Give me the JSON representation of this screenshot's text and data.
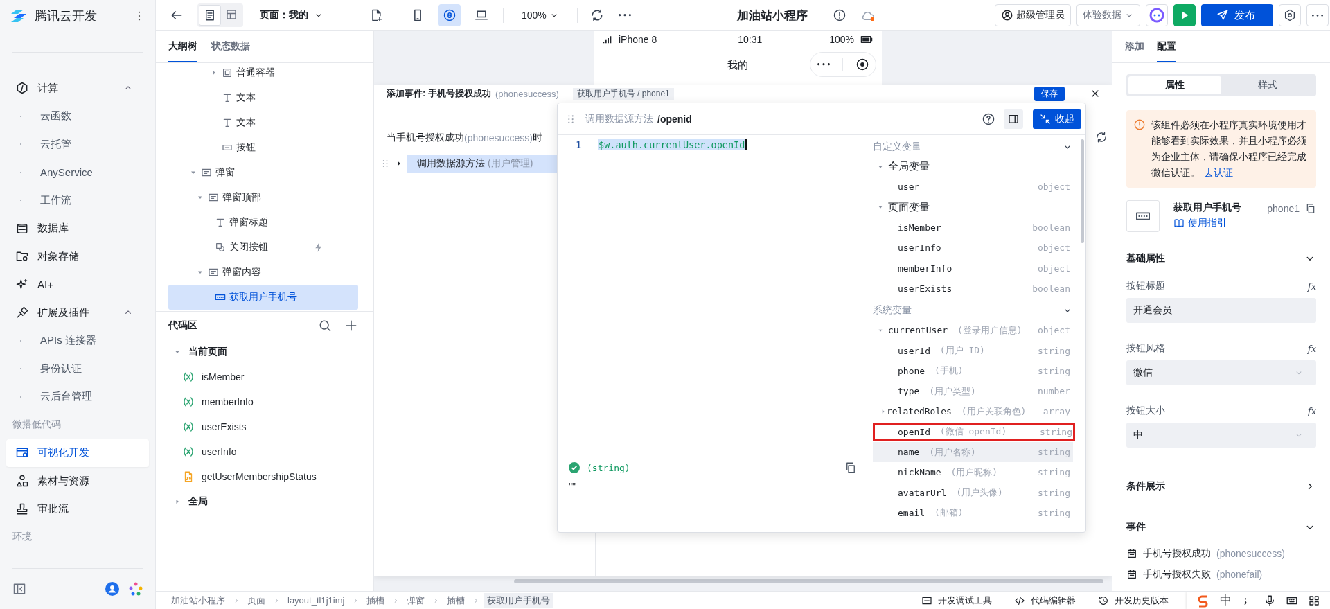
{
  "sidebar": {
    "brand": "腾讯云开发",
    "nav": [
      {
        "kind": "group",
        "label": "计算",
        "expanded": true,
        "children": [
          {
            "label": "云函数",
            "selected": false
          },
          {
            "label": "云托管",
            "selected": false
          },
          {
            "label": "AnyService",
            "selected": false
          },
          {
            "label": "工作流",
            "selected": false
          }
        ]
      },
      {
        "kind": "item",
        "label": "数据库",
        "selected": false
      },
      {
        "kind": "item",
        "label": "对象存储",
        "selected": false
      },
      {
        "kind": "item",
        "label": "AI+",
        "selected": false
      },
      {
        "kind": "group",
        "label": "扩展及插件",
        "expanded": true,
        "children": [
          {
            "label": "APIs 连接器",
            "selected": false
          },
          {
            "label": "身份认证",
            "selected": false
          },
          {
            "label": "云后台管理",
            "selected": false
          }
        ]
      },
      {
        "kind": "section",
        "label": "微搭低代码"
      },
      {
        "kind": "item",
        "label": "可视化开发",
        "selected": true
      },
      {
        "kind": "item",
        "label": "素材与资源",
        "selected": false
      },
      {
        "kind": "item",
        "label": "审批流",
        "selected": false
      },
      {
        "kind": "section",
        "label": "环境"
      }
    ]
  },
  "toolbar": {
    "view_modes": [
      {
        "selected": true
      },
      {
        "selected": false
      }
    ],
    "page": "页面：我的",
    "devices": [
      {
        "selected": false
      },
      {
        "selected": true
      },
      {
        "selected": false
      }
    ],
    "zoom": "100%",
    "app_title": "加油站小程序",
    "role": "超级管理员",
    "data_env": "体验数据",
    "publish": "发布"
  },
  "outline": {
    "tabs": [
      {
        "label": "大纲树",
        "selected": true
      },
      {
        "label": "状态数据",
        "selected": false
      }
    ],
    "continued": [
      {
        "kind": "container",
        "label": "普通容器",
        "expanded": false,
        "selected": false,
        "has_event": false
      },
      {
        "kind": "text",
        "label": "文本",
        "selected": false,
        "has_event": false
      },
      {
        "kind": "text",
        "label": "文本",
        "selected": false,
        "has_event": false
      },
      {
        "kind": "button",
        "label": "按钮",
        "selected": false,
        "has_event": false
      }
    ],
    "nodes": [
      {
        "kind": "popup",
        "label": "弹窗",
        "expanded": true,
        "selected": false,
        "has_event": false,
        "children": [
          {
            "kind": "popup",
            "label": "弹窗顶部",
            "expanded": true,
            "selected": false,
            "has_event": false,
            "children": [
              {
                "kind": "text",
                "label": "弹窗标题",
                "selected": false,
                "has_event": false
              },
              {
                "kind": "close-button",
                "label": "关闭按钮",
                "selected": false,
                "has_event": true
              }
            ]
          },
          {
            "kind": "popup",
            "label": "弹窗内容",
            "expanded": true,
            "selected": false,
            "has_event": false,
            "children": [
              {
                "kind": "phone-button",
                "label": "获取用户手机号",
                "selected": true,
                "has_event": false
              }
            ]
          }
        ]
      }
    ]
  },
  "code_area": {
    "title": "代码区",
    "groups": [
      {
        "label": "当前页面",
        "expanded": true,
        "children": [
          {
            "kind": "variable",
            "label": "isMember"
          },
          {
            "kind": "variable",
            "label": "memberInfo"
          },
          {
            "kind": "variable",
            "label": "userExists"
          },
          {
            "kind": "variable",
            "label": "userInfo"
          },
          {
            "kind": "script",
            "label": "getUserMembershipStatus"
          }
        ]
      },
      {
        "label": "全局",
        "expanded": false
      }
    ]
  },
  "phone": {
    "model": "iPhone 8",
    "time": "10:31",
    "battery": "100%",
    "title": "我的"
  },
  "event_panel": {
    "title": "添加事件: 手机号授权成功",
    "event_code": "(phonesuccess)",
    "component_chip": "获取用户手机号 / phone1",
    "save": "保存",
    "trigger_prefix": "当手机号授权成功",
    "trigger_code": "(phonesuccess)",
    "trigger_suffix": "时",
    "actions": [
      {
        "label": "调用数据源方法",
        "source": "(用户管理)",
        "selected": true,
        "expanded": false
      }
    ]
  },
  "expression_editor": {
    "path": "调用数据源方法",
    "field": "/openid",
    "collapse": "收起",
    "line_number": "1",
    "code": "$w.auth.currentUser.openId",
    "result_type": "(string)",
    "result_value": "\"\"",
    "sections": [
      {
        "label": "自定义变量",
        "expanded": true,
        "groups": [
          {
            "label": "全局变量",
            "expanded": true,
            "items": [
              {
                "name": "user",
                "type": "object"
              }
            ]
          },
          {
            "label": "页面变量",
            "expanded": true,
            "items": [
              {
                "name": "isMember",
                "type": "boolean"
              },
              {
                "name": "userInfo",
                "type": "object"
              },
              {
                "name": "memberInfo",
                "type": "object"
              },
              {
                "name": "userExists",
                "type": "boolean"
              }
            ]
          }
        ]
      },
      {
        "label": "系统变量",
        "expanded": true,
        "groups": [
          {
            "label": "currentUser",
            "note": "(登录用户信息)",
            "type": "object",
            "expanded": true,
            "items": [
              {
                "name": "userId",
                "note": "(用户 ID)",
                "type": "string",
                "highlighted": false,
                "hovered": false
              },
              {
                "name": "phone",
                "note": "(手机)",
                "type": "string",
                "highlighted": false,
                "hovered": false
              },
              {
                "name": "type",
                "note": "(用户类型)",
                "type": "number",
                "highlighted": false,
                "hovered": false
              },
              {
                "name": "relatedRoles",
                "note": "(用户关联角色)",
                "type": "array",
                "expanded": false,
                "highlighted": false,
                "hovered": false
              },
              {
                "name": "openId",
                "note": "(微信 openId)",
                "type": "string",
                "highlighted": true,
                "hovered": false
              },
              {
                "name": "name",
                "note": "(用户名称)",
                "type": "string",
                "highlighted": false,
                "hovered": true
              },
              {
                "name": "nickName",
                "note": "(用户昵称)",
                "type": "string",
                "highlighted": false,
                "hovered": false
              },
              {
                "name": "avatarUrl",
                "note": "(用户头像)",
                "type": "string",
                "highlighted": false,
                "hovered": false
              },
              {
                "name": "email",
                "note": "(邮箱)",
                "type": "string",
                "highlighted": false,
                "hovered": false
              }
            ]
          }
        ]
      }
    ]
  },
  "inspector": {
    "tabs": [
      {
        "label": "添加",
        "selected": false
      },
      {
        "label": "配置",
        "selected": true
      }
    ],
    "modes": [
      {
        "label": "属性",
        "selected": true
      },
      {
        "label": "样式",
        "selected": false
      }
    ],
    "notice": "该组件必须在小程序真实环境使用才能够看到实际效果，并且小程序必须为企业主体，请确保小程序已经完成微信认证。",
    "notice_link": "去认证",
    "component": {
      "name": "获取用户手机号",
      "guide": "使用指引",
      "id": "phone1"
    },
    "sections": [
      {
        "kind": "form",
        "label": "基础属性",
        "expanded": true,
        "fields": [
          {
            "kind": "input",
            "label": "按钮标题",
            "value": "开通会员",
            "formula": "fx"
          },
          {
            "kind": "select",
            "label": "按钮风格",
            "value": "微信",
            "formula": "fx"
          },
          {
            "kind": "select",
            "label": "按钮大小",
            "value": "中",
            "formula": "fx"
          }
        ]
      },
      {
        "label": "条件展示",
        "expanded": false
      },
      {
        "kind": "events",
        "label": "事件",
        "expanded": true,
        "events": [
          {
            "label": "手机号授权成功",
            "code": "(phonesuccess)"
          },
          {
            "label": "手机号授权失败",
            "code": "(phonefail)"
          }
        ]
      }
    ]
  },
  "breadcrumb": [
    {
      "label": "加油站小程序",
      "selected": false
    },
    {
      "label": "页面",
      "selected": false
    },
    {
      "label": "layout_tl1j1imj",
      "selected": false
    },
    {
      "label": "插槽",
      "selected": false
    },
    {
      "label": "弹窗",
      "selected": false
    },
    {
      "label": "插槽",
      "selected": false
    },
    {
      "label": "获取用户手机号",
      "selected": true
    }
  ],
  "dev_tools": [
    "开发调试工具",
    "代码编辑器",
    "开发历史版本"
  ],
  "ime": {
    "mode": "中"
  }
}
